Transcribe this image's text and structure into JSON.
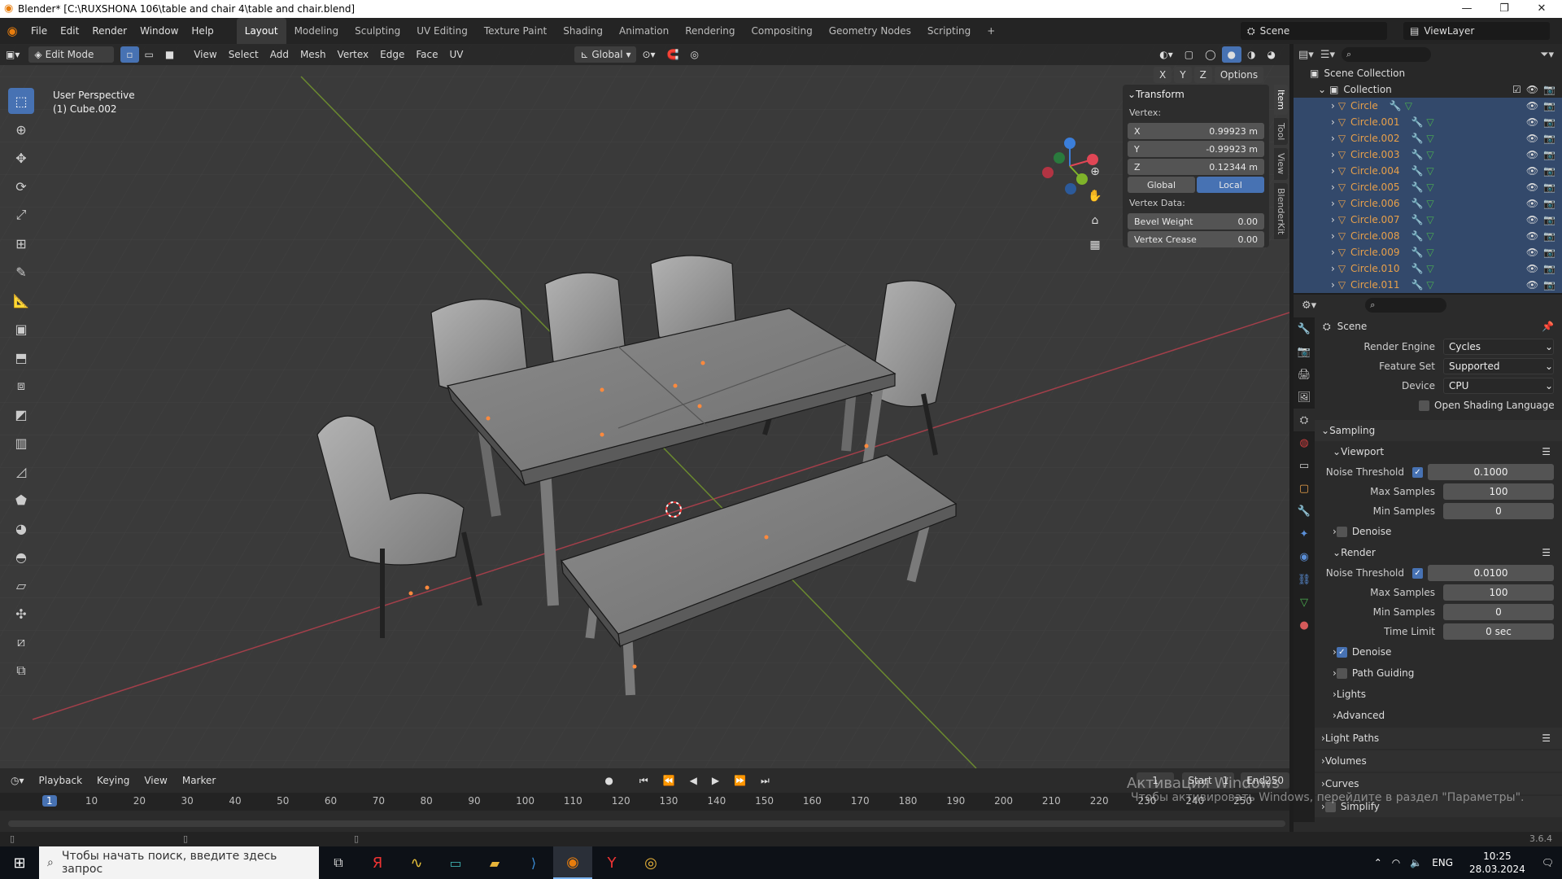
{
  "titlebar": {
    "title": "Blender* [C:\\RUXSHONA 106\\table and chair 4\\table and chair.blend]",
    "min": "—",
    "max": "❐",
    "close": "✕"
  },
  "menubar": {
    "menus": [
      "File",
      "Edit",
      "Render",
      "Window",
      "Help"
    ],
    "workspaces": [
      "Layout",
      "Modeling",
      "Sculpting",
      "UV Editing",
      "Texture Paint",
      "Shading",
      "Animation",
      "Rendering",
      "Compositing",
      "Geometry Nodes",
      "Scripting"
    ],
    "add_tab": "+",
    "scene": "Scene",
    "viewlayer": "ViewLayer"
  },
  "viewport_header": {
    "mode": "Edit Mode",
    "menus": [
      "View",
      "Select",
      "Add",
      "Mesh",
      "Vertex",
      "Edge",
      "Face",
      "UV"
    ],
    "orientation": "Global",
    "options": "Options",
    "axes": [
      "X",
      "Y",
      "Z"
    ]
  },
  "viewport": {
    "perspective": "User Perspective",
    "object": "(1) Cube.002",
    "accent": "#e8744a",
    "selected_color": "#ff8a3d"
  },
  "npanel": {
    "section": "Transform",
    "vertex_label": "Vertex:",
    "x_label": "X",
    "x_val": "0.99923 m",
    "y_label": "Y",
    "y_val": "-0.99923 m",
    "z_label": "Z",
    "z_val": "0.12344 m",
    "global": "Global",
    "local": "Local",
    "vdata_label": "Vertex Data:",
    "bevel_label": "Bevel Weight",
    "bevel_val": "0.00",
    "crease_label": "Vertex Crease",
    "crease_val": "0.00",
    "tabs": [
      "Item",
      "Tool",
      "View",
      "BlenderKit"
    ]
  },
  "outliner": {
    "scene_collection": "Scene Collection",
    "collection": "Collection",
    "items": [
      "Circle",
      "Circle.001",
      "Circle.002",
      "Circle.003",
      "Circle.004",
      "Circle.005",
      "Circle.006",
      "Circle.007",
      "Circle.008",
      "Circle.009",
      "Circle.010",
      "Circle.011"
    ]
  },
  "properties": {
    "context": "Scene",
    "render_engine_label": "Render Engine",
    "render_engine": "Cycles",
    "feature_set_label": "Feature Set",
    "feature_set": "Supported",
    "device_label": "Device",
    "device": "CPU",
    "osl": "Open Shading Language",
    "sampling": "Sampling",
    "viewport": "Viewport",
    "noise_threshold": "Noise Threshold",
    "vp_noise": "0.1000",
    "max_samples": "Max Samples",
    "vp_max": "100",
    "min_samples": "Min Samples",
    "vp_min": "0",
    "denoise": "Denoise",
    "render": "Render",
    "r_noise": "0.0100",
    "r_max": "100",
    "r_min": "0",
    "time_limit": "Time Limit",
    "r_time": "0 sec",
    "path_guiding": "Path Guiding",
    "lights": "Lights",
    "advanced": "Advanced",
    "light_paths": "Light Paths",
    "volumes": "Volumes",
    "curves": "Curves",
    "simplify": "Simplify"
  },
  "timeline": {
    "menus": [
      "Playback",
      "Keying",
      "View",
      "Marker"
    ],
    "current_frame": "1",
    "start_label": "Start",
    "start": "1",
    "end_label": "End",
    "end": "250",
    "ticks": [
      "1",
      "10",
      "20",
      "30",
      "40",
      "50",
      "60",
      "70",
      "80",
      "90",
      "100",
      "110",
      "120",
      "130",
      "140",
      "150",
      "160",
      "170",
      "180",
      "190",
      "200",
      "210",
      "220",
      "230",
      "240",
      "250"
    ]
  },
  "watermark": {
    "line1": "Активация Windows",
    "line2": "Чтобы активировать Windows, перейдите в раздел \"Параметры\"."
  },
  "statusbar": {
    "version": "3.6.4"
  },
  "taskbar": {
    "search_placeholder": "Чтобы начать поиск, введите здесь запрос",
    "lang": "ENG",
    "time": "10:25",
    "date": "28.03.2024"
  }
}
